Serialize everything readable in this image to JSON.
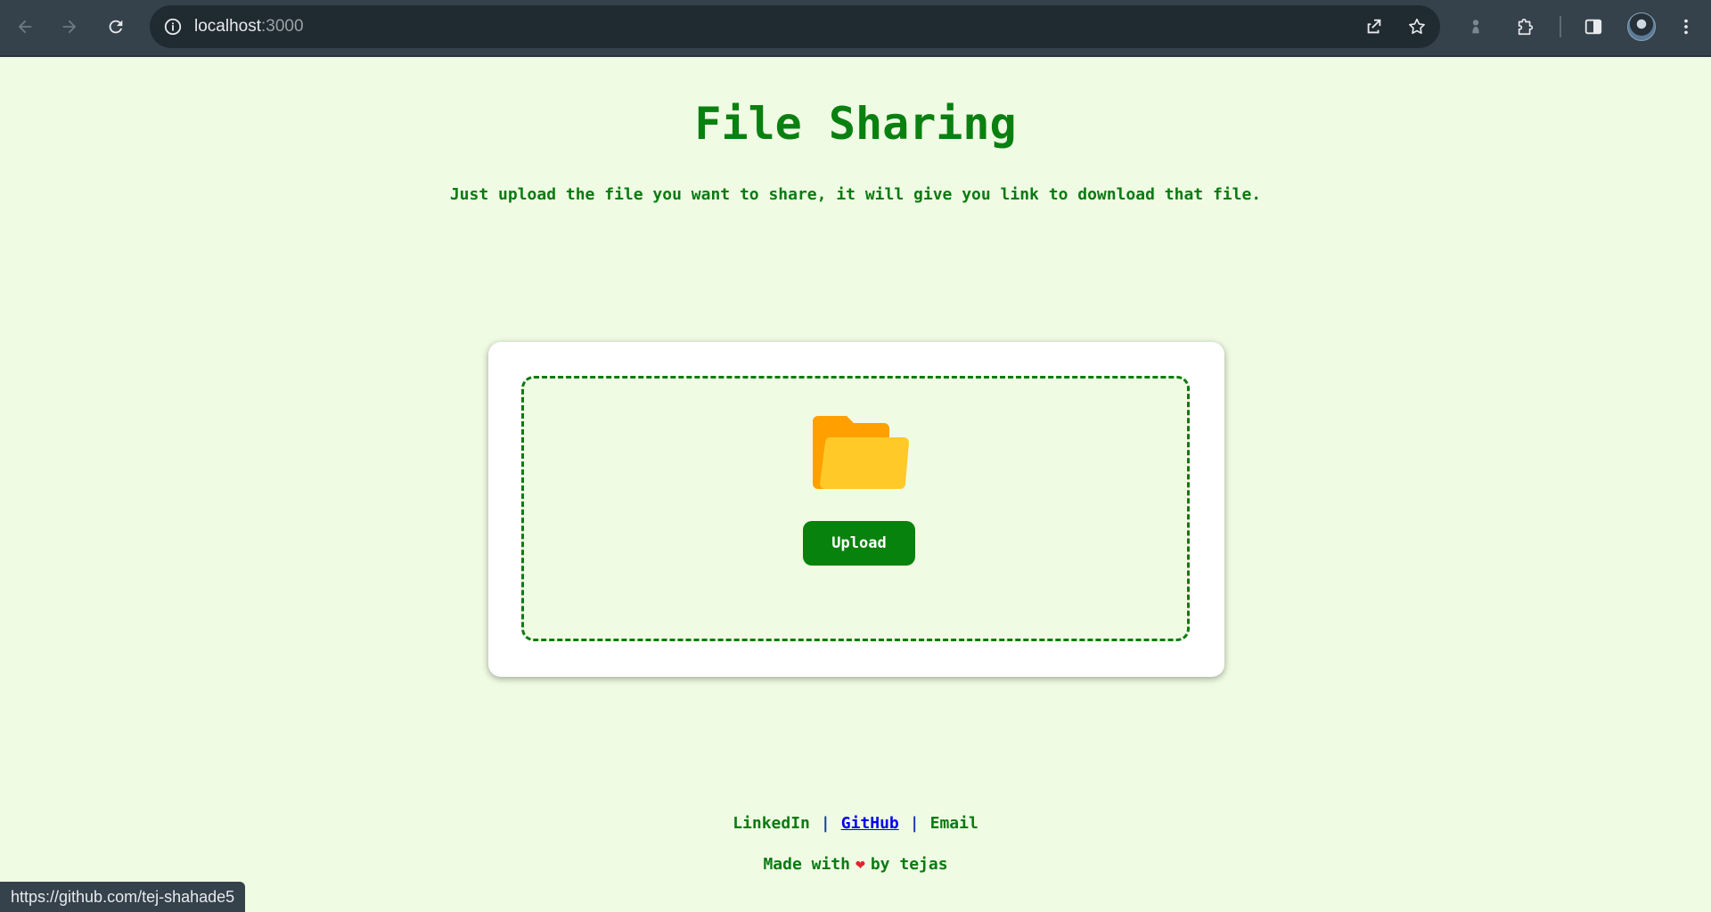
{
  "browser": {
    "url_host": "localhost",
    "url_port": ":3000",
    "status_url": "https://github.com/tej-shahade5"
  },
  "page": {
    "title": "File Sharing",
    "subtitle": "Just upload the file you want to share, it will give you link to download that file.",
    "upload_button": "Upload"
  },
  "footer": {
    "links": {
      "linkedin": "LinkedIn",
      "github": "GitHub",
      "email": "Email",
      "separator": "|"
    },
    "made_with_prefix": "Made with",
    "heart": "❤",
    "made_with_suffix": "by tejas"
  },
  "colors": {
    "page_bg": "#effbe3",
    "brand_green": "#0a8011",
    "button_green": "#07820d",
    "chrome_bg": "#35414b",
    "folder_back": "#ffa000",
    "folder_front": "#ffca28"
  },
  "icons": {
    "back": "arrow-left-icon",
    "forward": "arrow-right-icon",
    "reload": "reload-icon",
    "site_info": "info-icon",
    "share": "share-icon",
    "bookmark": "star-icon",
    "extension_status": "pawn-icon",
    "extensions": "puzzle-icon",
    "side_panel": "side-panel-icon",
    "menu": "kebab-menu-icon",
    "folder": "folder-icon",
    "heart": "heart-icon"
  }
}
